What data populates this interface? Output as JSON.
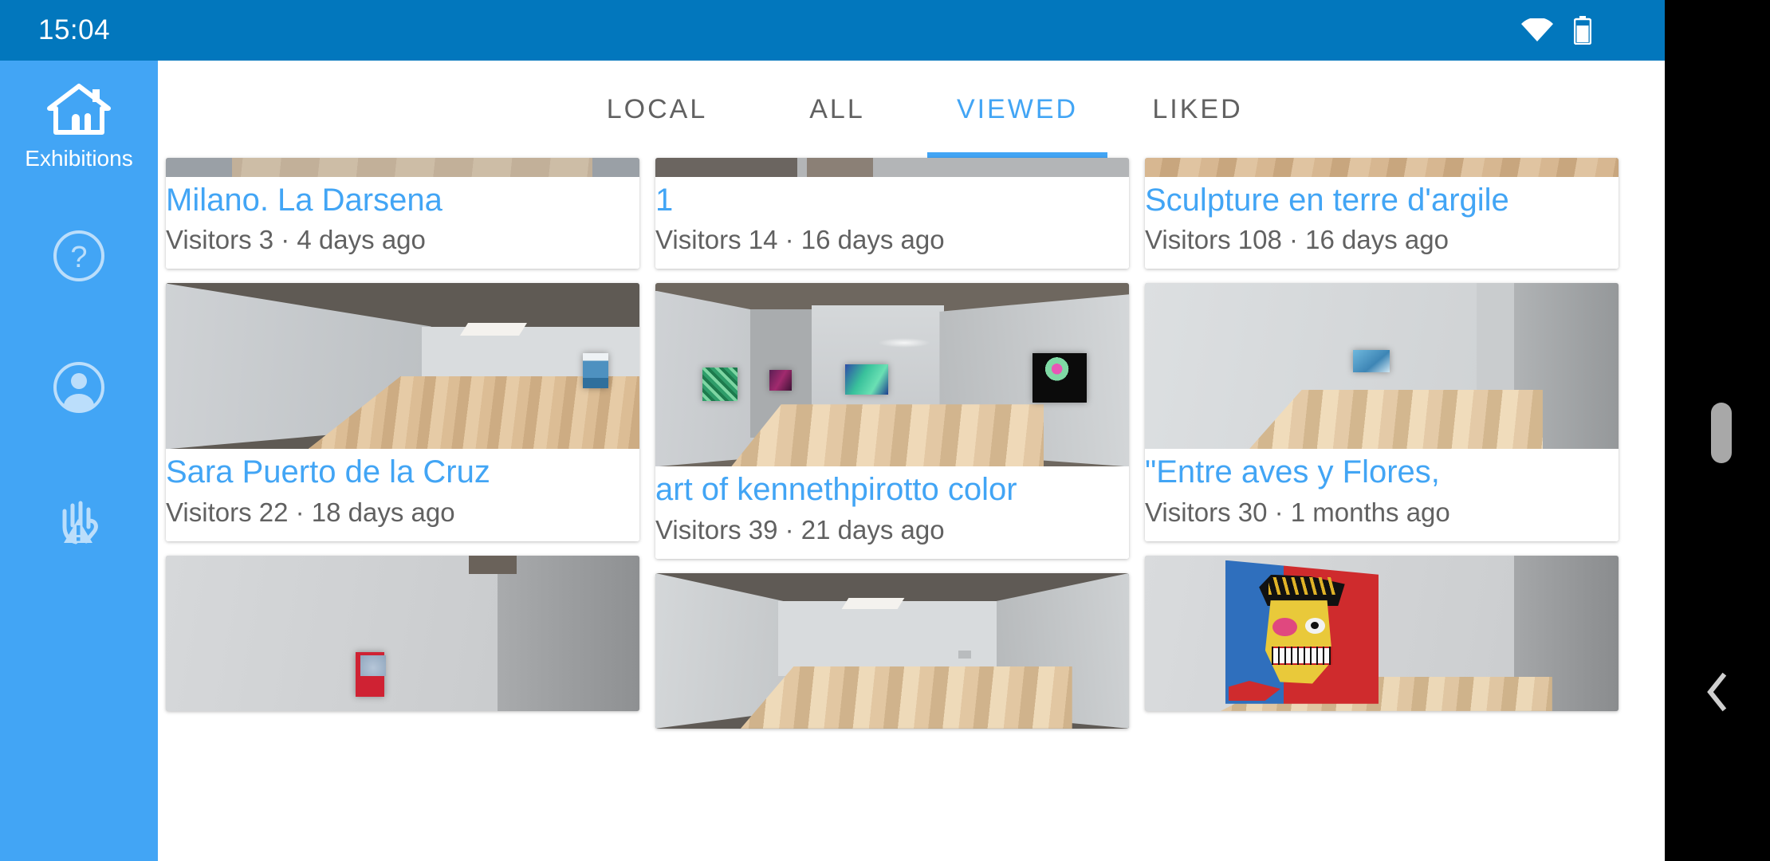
{
  "statusbar": {
    "time": "15:04",
    "icons": [
      "wifi-icon",
      "battery-icon"
    ]
  },
  "sidebar": {
    "background_color": "#42a5f5",
    "items": [
      {
        "label": "Exhibitions",
        "icon": "home-exhibitions-icon"
      },
      {
        "label": "",
        "icon": "help-circle-icon"
      },
      {
        "label": "",
        "icon": "account-circle-icon"
      },
      {
        "label": "",
        "icon": "privacy-hand-warning-icon"
      }
    ]
  },
  "tabs": {
    "active_color": "#42a5f5",
    "inactive_color": "#616161",
    "items": [
      {
        "label": "LOCAL",
        "active": false
      },
      {
        "label": "ALL",
        "active": false
      },
      {
        "label": "VIEWED",
        "active": true
      },
      {
        "label": "LIKED",
        "active": false
      }
    ]
  },
  "exhibitions": {
    "columns": [
      [
        {
          "title": "Milano. La Darsena",
          "subtitle": "Visitors 3 · 4 days ago",
          "scene": "room-stone-floor",
          "thumb_height": 24
        },
        {
          "title": "Sara Puerto de la Cruz",
          "subtitle": "Visitors 22 · 18 days ago",
          "scene": "room-wood-skylight",
          "thumb_height": 208
        },
        {
          "title": "",
          "subtitle": "",
          "scene": "room-red-painting",
          "thumb_height": 195
        }
      ],
      [
        {
          "title": "1",
          "subtitle": "Visitors 14 · 16 days ago",
          "scene": "room-dark-corner",
          "thumb_height": 24
        },
        {
          "title": "art of kennethpirotto color",
          "subtitle": "Visitors 39 · 21 days ago",
          "scene": "room-colorful-art",
          "thumb_height": 230
        },
        {
          "title": "",
          "subtitle": "",
          "scene": "room-empty-bright",
          "thumb_height": 195
        }
      ],
      [
        {
          "title": "Sculpture en terre d'argile",
          "subtitle": "Visitors 108 · 16 days ago",
          "scene": "room-parquet",
          "thumb_height": 24
        },
        {
          "title": "\"Entre aves y Flores,",
          "subtitle": "Visitors 30 · 1 months ago",
          "scene": "room-small-blue-pic",
          "thumb_height": 208
        },
        {
          "title": "",
          "subtitle": "",
          "scene": "room-basquiat",
          "thumb_height": 195
        }
      ]
    ]
  },
  "navbar": {
    "background_color": "#000000",
    "back_icon": "back-chevron-icon",
    "scrollbar": "vertical-scrollbar-thumb"
  }
}
